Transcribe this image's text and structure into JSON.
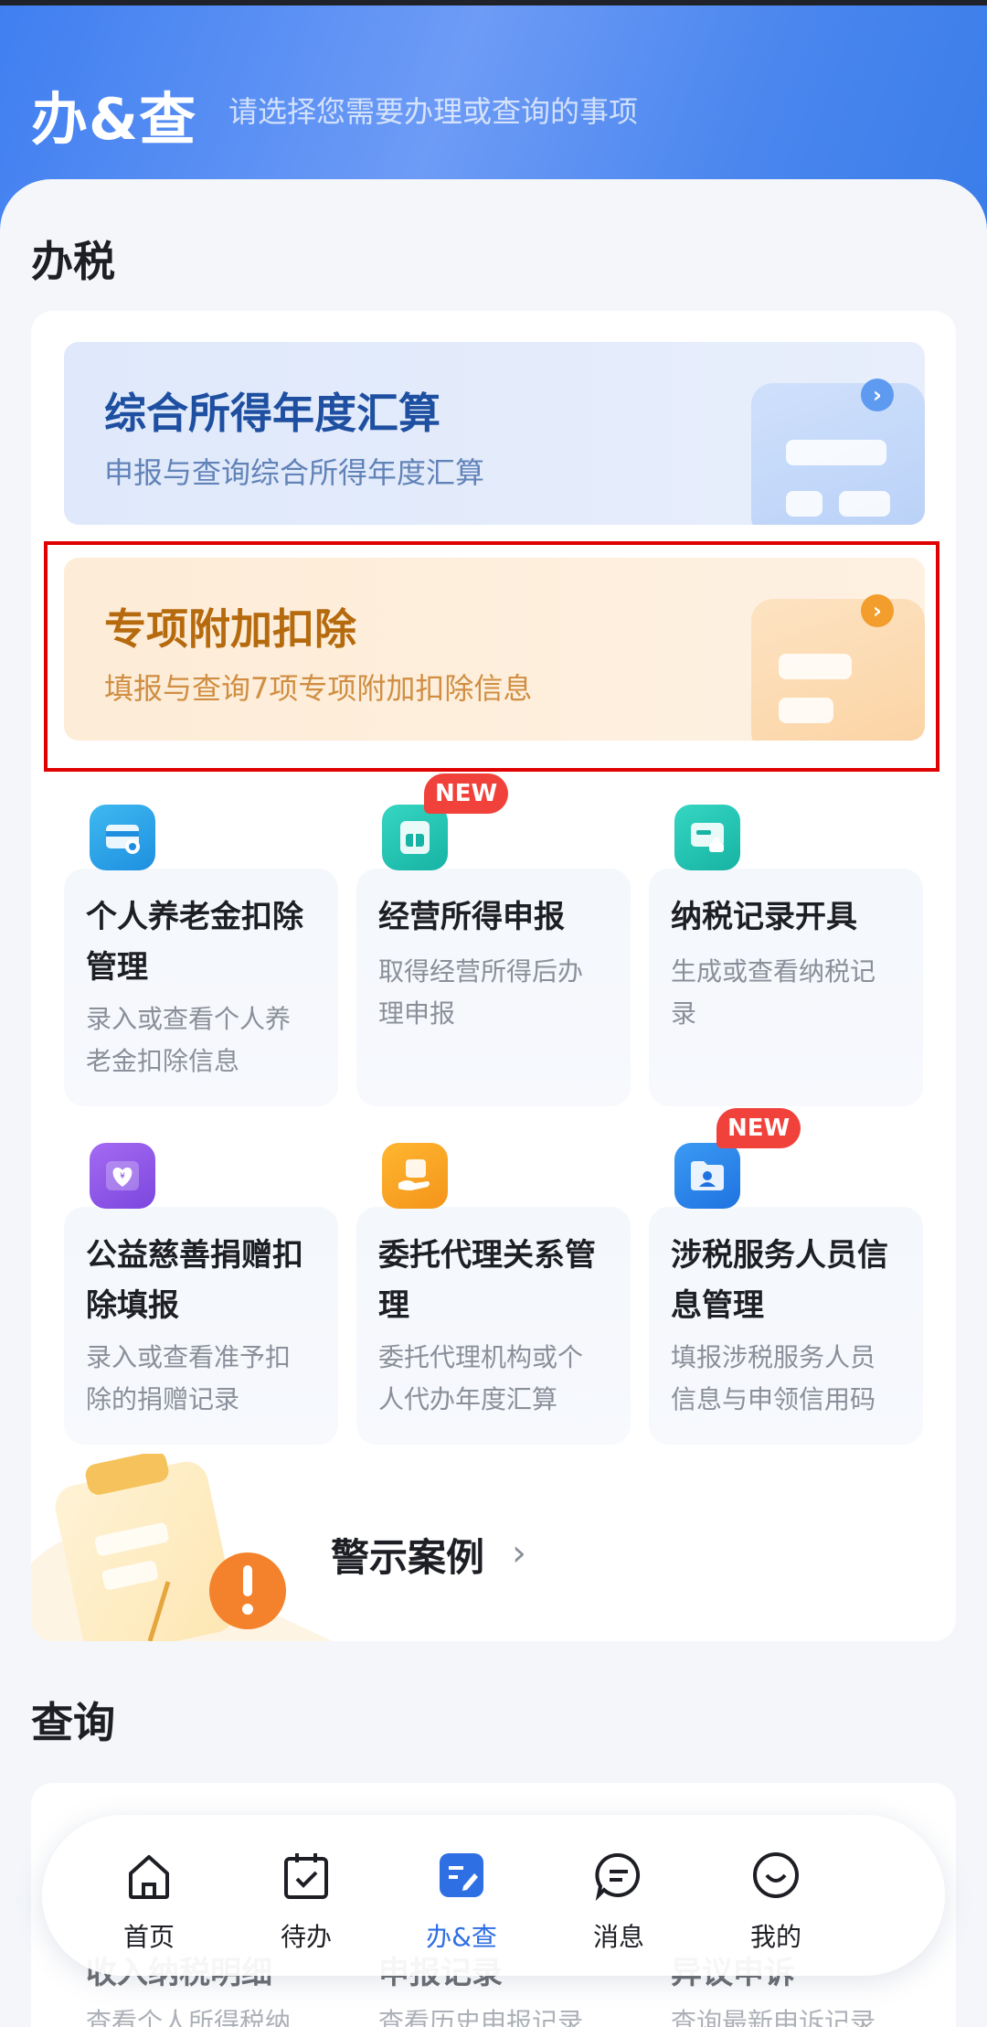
{
  "header": {
    "title": "办&查",
    "subtitle": "请选择您需要办理或查询的事项"
  },
  "sections": {
    "tax": "办税",
    "query": "查询"
  },
  "banners": [
    {
      "title": "综合所得年度汇算",
      "desc": "申报与查询综合所得年度汇算",
      "color": "#1e4fa0"
    },
    {
      "title": "专项附加扣除",
      "desc": "填报与查询7项专项附加扣除信息",
      "color": "#b66a0e"
    }
  ],
  "cards": [
    {
      "title": "个人养老金扣除管理",
      "desc": "录入或查看个人养老金扣除信息",
      "icon": "card-icon"
    },
    {
      "title": "经营所得申报",
      "desc": "取得经营所得后办理申报",
      "icon": "document-icon",
      "badge": "NEW"
    },
    {
      "title": "纳税记录开具",
      "desc": "生成或查看纳税记录",
      "icon": "stamp-icon"
    },
    {
      "title": "公益慈善捐赠扣除填报",
      "desc": "录入或查看准予扣除的捐赠记录",
      "icon": "charity-icon"
    },
    {
      "title": "委托代理关系管理",
      "desc": "委托代理机构或个人代办年度汇算",
      "icon": "hand-document-icon"
    },
    {
      "title": "涉税服务人员信息管理",
      "desc": "填报涉税服务人员信息与申领信用码",
      "icon": "person-folder-icon",
      "badge": "NEW"
    }
  ],
  "warning": {
    "label": "警示案例"
  },
  "query_peek": [
    {
      "title": "收入纳税明细",
      "desc": "查看个人所得税纳"
    },
    {
      "title": "申报记录",
      "desc": "查看历史申报记录"
    },
    {
      "title": "异议申诉",
      "desc": "查询最新申诉记录"
    }
  ],
  "tabbar": [
    {
      "label": "首页",
      "icon": "home-icon"
    },
    {
      "label": "待办",
      "icon": "calendar-check-icon"
    },
    {
      "label": "办&查",
      "icon": "tasks-icon",
      "active": true
    },
    {
      "label": "消息",
      "icon": "message-icon"
    },
    {
      "label": "我的",
      "icon": "smile-icon"
    }
  ],
  "colors": {
    "accent": "#2f6fe4",
    "highlight_border": "#e00000",
    "badge": "#f0413b"
  }
}
